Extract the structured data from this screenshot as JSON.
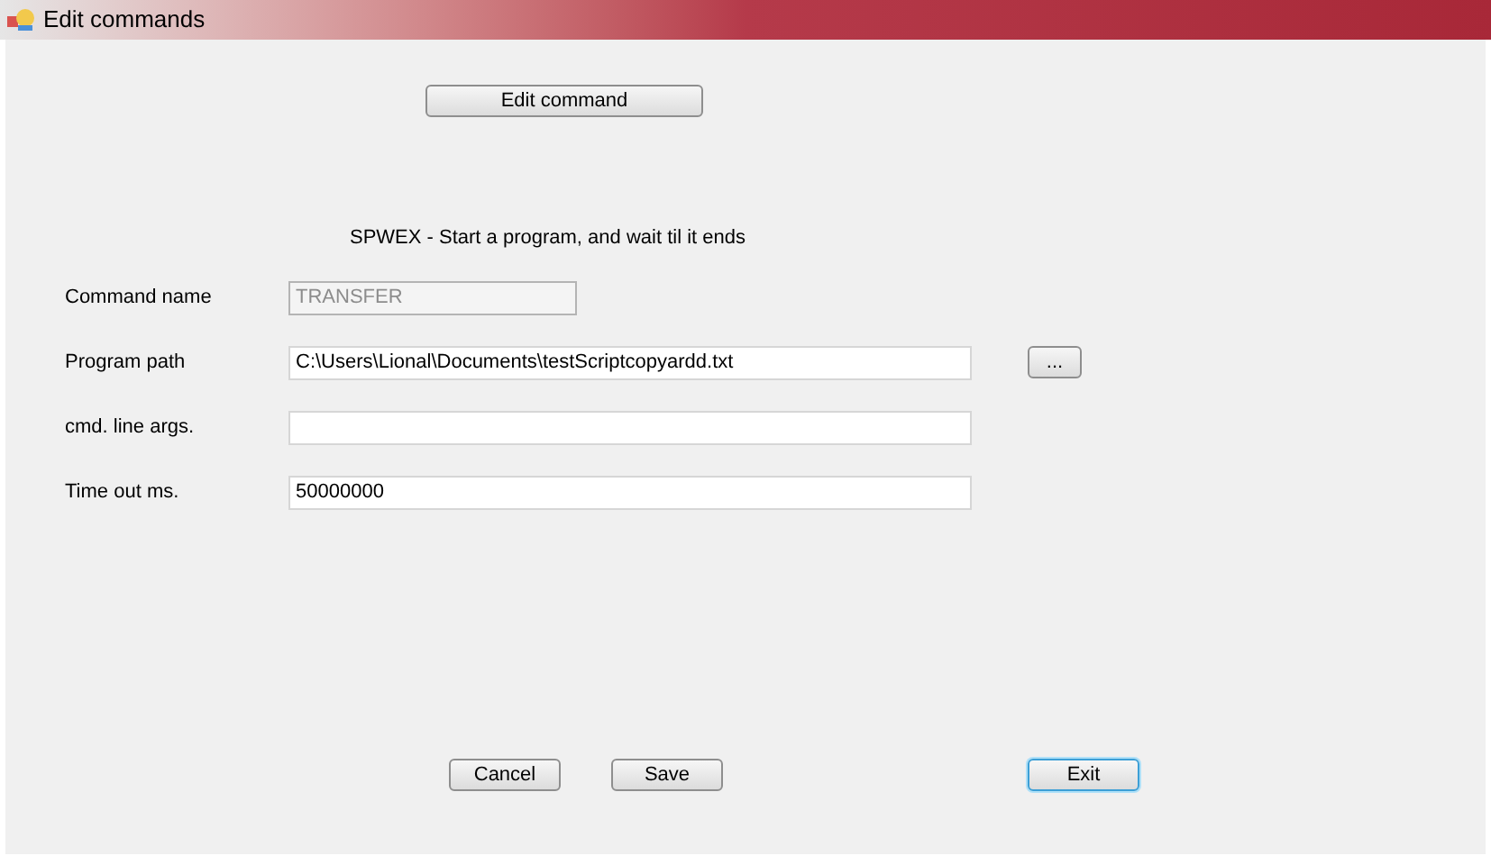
{
  "window": {
    "title": "Edit commands"
  },
  "edit_button": "Edit command",
  "description": "SPWEX - Start a program, and wait til it ends",
  "fields": [
    {
      "label": "Command name",
      "value": "TRANSFER",
      "disabled": true,
      "kind": "compact"
    },
    {
      "label": "Program path",
      "value": "C:\\Users\\Lional\\Documents\\testScriptcopyardd.txt",
      "disabled": false,
      "kind": "wide",
      "browse": "..."
    },
    {
      "label": "cmd. line args.",
      "disabled": false,
      "kind": "wide"
    },
    {
      "label": "Time out ms.",
      "value": "50000000",
      "disabled": false,
      "kind": "wide"
    }
  ],
  "buttons": [
    {
      "label": "Cancel",
      "focused": false
    },
    {
      "label": "Save",
      "focused": false
    },
    {
      "label": "Exit",
      "focused": true
    }
  ]
}
